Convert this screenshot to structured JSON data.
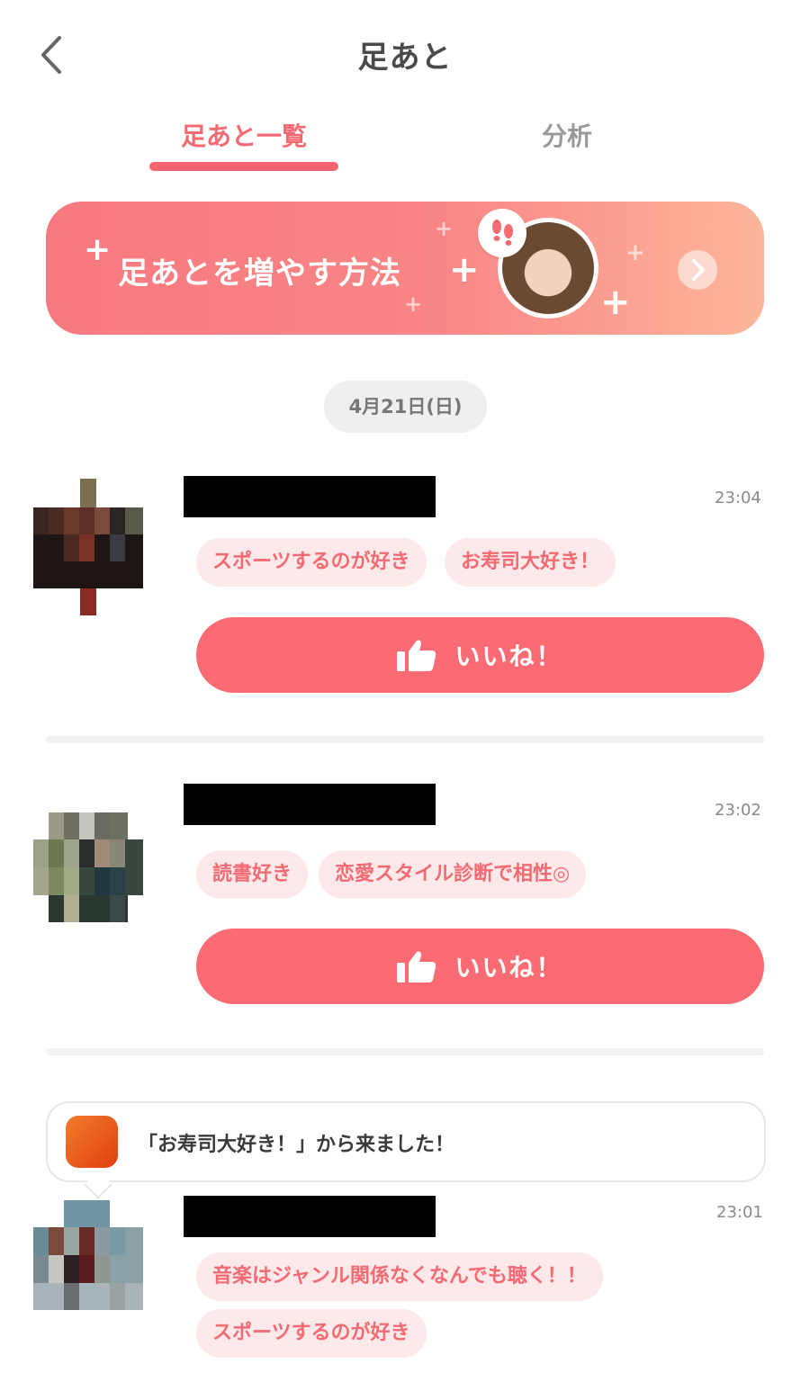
{
  "header": {
    "title": "足あと"
  },
  "tabs": [
    {
      "label": "足あと一覧"
    },
    {
      "label": "分析"
    }
  ],
  "banner": {
    "text": "足あとを増やす方法"
  },
  "date_chip": "4月21日(日)",
  "entries": [
    {
      "time": "23:04",
      "tags": [
        "スポーツするのが好き",
        "お寿司大好き！"
      ],
      "like_label": "いいね！"
    },
    {
      "time": "23:02",
      "tags": [
        "読書好き",
        "恋愛スタイル診断で相性◎"
      ],
      "like_label": "いいね！"
    },
    {
      "callout": "「お寿司大好き！」から来ました！",
      "time": "23:01",
      "tags": [
        "音楽はジャンル関係なくなんでも聴く！！",
        "スポーツするのが好き"
      ]
    }
  ],
  "colors": {
    "accent": "#f46a72",
    "like_button": "#fb6b73",
    "tag_bg": "#fde9ea"
  }
}
